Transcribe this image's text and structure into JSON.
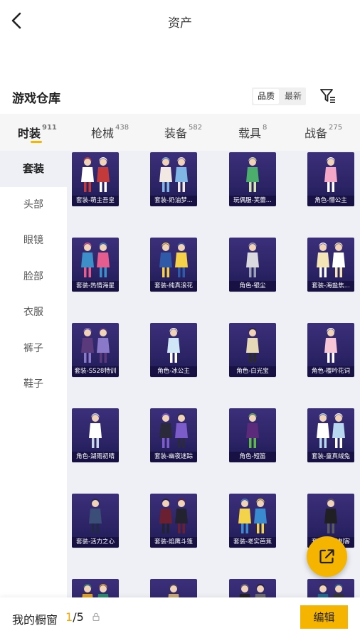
{
  "header": {
    "title": "资产"
  },
  "section": {
    "title": "游戏仓库",
    "sort_options": [
      "品质",
      "最新"
    ],
    "sort_selected": "品质"
  },
  "tabs": [
    {
      "label": "时装",
      "count": "911",
      "active": true
    },
    {
      "label": "枪械",
      "count": "438",
      "active": false
    },
    {
      "label": "装备",
      "count": "582",
      "active": false
    },
    {
      "label": "载具",
      "count": "8",
      "active": false
    },
    {
      "label": "战备",
      "count": "275",
      "active": false
    }
  ],
  "sidebar": {
    "items": [
      {
        "label": "套装",
        "active": true
      },
      {
        "label": "头部",
        "active": false
      },
      {
        "label": "眼镜",
        "active": false
      },
      {
        "label": "脸部",
        "active": false
      },
      {
        "label": "衣服",
        "active": false
      },
      {
        "label": "裤子",
        "active": false
      },
      {
        "label": "鞋子",
        "active": false
      }
    ]
  },
  "items": [
    {
      "label": "套装-萌主吾皇",
      "figures": 2,
      "colors": [
        "#ffffff",
        "#c43a3a"
      ]
    },
    {
      "label": "套装-奶油梦...",
      "figures": 2,
      "colors": [
        "#f3e9e3",
        "#7fb6e6"
      ]
    },
    {
      "label": "玩偶服-芙蕾...",
      "figures": 1,
      "colors": [
        "#4cae6c",
        "#d8e6b0"
      ]
    },
    {
      "label": "角色-懵公主",
      "figures": 1,
      "colors": [
        "#f4a7c6",
        "#ffffff"
      ]
    },
    {
      "label": "套装-热情海星",
      "figures": 2,
      "colors": [
        "#3c8fc9",
        "#e55c8e"
      ]
    },
    {
      "label": "套装-纯真浪花",
      "figures": 2,
      "colors": [
        "#2f5aa8",
        "#f5d14a"
      ]
    },
    {
      "label": "角色-银尘",
      "figures": 1,
      "colors": [
        "#d9d9df",
        "#9aa0b8"
      ]
    },
    {
      "label": "套装-海盐焦...",
      "figures": 2,
      "colors": [
        "#f3e5b5",
        "#ffffff"
      ]
    },
    {
      "label": "套装-SS28特训",
      "figures": 2,
      "colors": [
        "#5a3a7a",
        "#8a78c8"
      ]
    },
    {
      "label": "角色-冰公主",
      "figures": 1,
      "colors": [
        "#cfe6f7",
        "#ffffff"
      ]
    },
    {
      "label": "角色-白光宝",
      "figures": 1,
      "colors": [
        "#e6d9b8",
        "#2b2b2b"
      ]
    },
    {
      "label": "角色-樱吟花词",
      "figures": 1,
      "colors": [
        "#f6c5d6",
        "#ffffff"
      ]
    },
    {
      "label": "角色-湖雨初晴",
      "figures": 1,
      "colors": [
        "#ffffff",
        "#c9d8e6"
      ]
    },
    {
      "label": "套装-幽夜迷踪",
      "figures": 2,
      "colors": [
        "#2a2a3a",
        "#7b5cc8"
      ]
    },
    {
      "label": "角色-短笛",
      "figures": 1,
      "colors": [
        "#5b2a7a",
        "#5fb84a"
      ]
    },
    {
      "label": "套装-童真绒兔",
      "figures": 2,
      "colors": [
        "#ffffff",
        "#b8d8f0"
      ]
    },
    {
      "label": "套装-活力之心",
      "figures": 1,
      "colors": [
        "#3b4e78",
        "#1f2a44"
      ]
    },
    {
      "label": "套装-焰鹰斗篷",
      "figures": 2,
      "colors": [
        "#6a2030",
        "#222230"
      ]
    },
    {
      "label": "套装-老实芭蕉",
      "figures": 2,
      "colors": [
        "#f2d34a",
        "#3a8ad0"
      ]
    },
    {
      "label": "套装-暗影刺客",
      "figures": 1,
      "colors": [
        "#1f1f24",
        "#5a5a62"
      ]
    },
    {
      "label": "",
      "figures": 2,
      "colors": [
        "#e0a020",
        "#2a8a6a"
      ]
    },
    {
      "label": "",
      "figures": 1,
      "colors": [
        "#c8a870",
        "#4a4a4a"
      ]
    },
    {
      "label": "",
      "figures": 2,
      "colors": [
        "#222222",
        "#6a6a6a"
      ]
    },
    {
      "label": "",
      "figures": 2,
      "colors": [
        "#1f6a8a",
        "#333333"
      ]
    }
  ],
  "bottom": {
    "showcase_label": "我的橱窗",
    "showcase_current": "1",
    "showcase_total": "/5",
    "edit_label": "编辑"
  },
  "icons": {
    "back": "chevron-left-icon",
    "filter": "filter-icon",
    "fab": "share-icon",
    "lock": "lock-icon"
  },
  "colors": {
    "accent": "#f5b400",
    "grid_bg": "#eef0f5",
    "card_bg": "#2c2466"
  }
}
